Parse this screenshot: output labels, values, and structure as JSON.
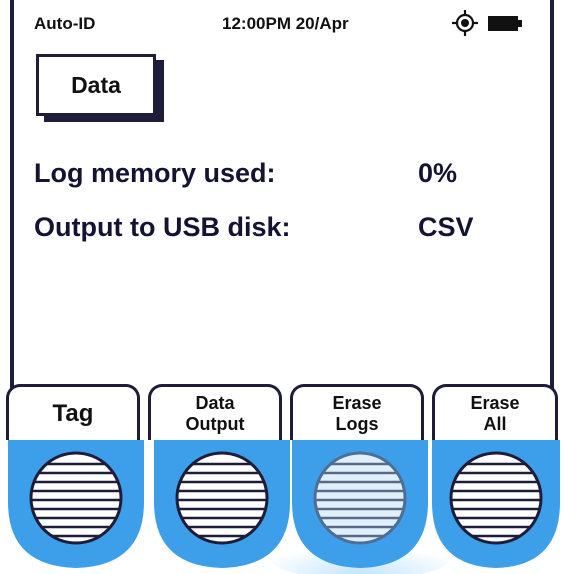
{
  "status_bar": {
    "mode": "Auto-ID",
    "time_date": "12:00PM 20/Apr",
    "icons": [
      "locate-icon",
      "battery-full-icon"
    ]
  },
  "header": {
    "title_button": "Data"
  },
  "rows": [
    {
      "label": "Log memory used:",
      "value": "0%"
    },
    {
      "label": "Output to USB disk:",
      "value": "CSV"
    }
  ],
  "softkeys": [
    {
      "line1": "Tag",
      "line2": ""
    },
    {
      "line1": "Data",
      "line2": "Output"
    },
    {
      "line1": "Erase",
      "line2": "Logs"
    },
    {
      "line1": "Erase",
      "line2": "All"
    }
  ],
  "colors": {
    "frame": "#1d1d3a",
    "hardware_button": "#3d9fea",
    "text": "#111111"
  },
  "pressed_hardware_button": 3
}
